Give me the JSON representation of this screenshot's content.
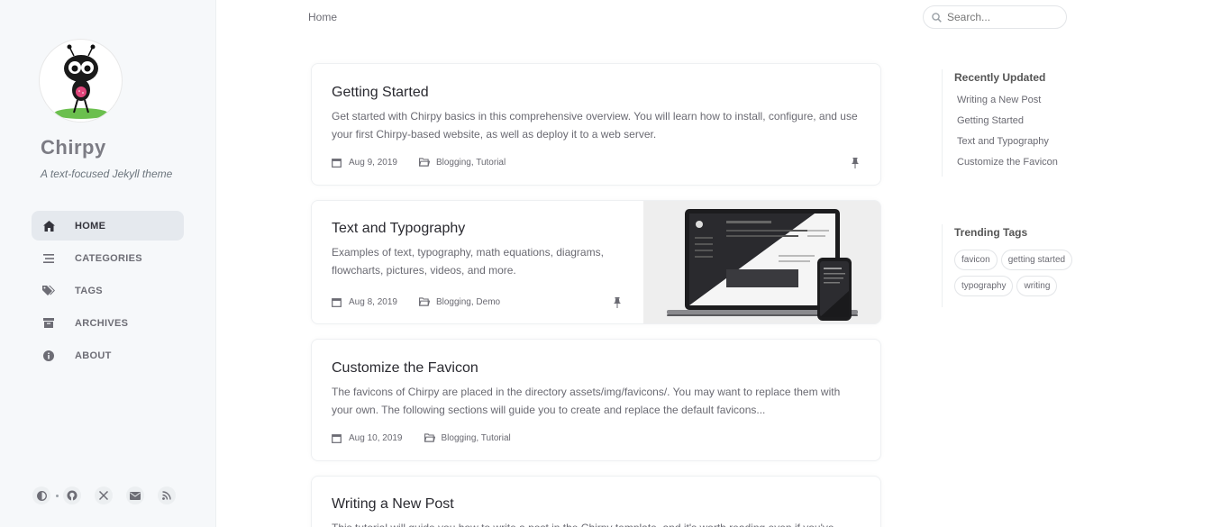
{
  "site": {
    "title": "Chirpy",
    "subtitle": "A text-focused Jekyll theme",
    "avatar_icon": "ant-mascot-avatar"
  },
  "nav": {
    "items": [
      {
        "label": "HOME",
        "icon": "home-icon",
        "active": true
      },
      {
        "label": "CATEGORIES",
        "icon": "stream-icon",
        "active": false
      },
      {
        "label": "TAGS",
        "icon": "tags-icon",
        "active": false
      },
      {
        "label": "ARCHIVES",
        "icon": "archive-icon",
        "active": false
      },
      {
        "label": "ABOUT",
        "icon": "info-circle-icon",
        "active": false
      }
    ]
  },
  "sidebar_bottom": {
    "icons": [
      "theme-toggle-icon",
      "github-icon",
      "x-twitter-icon",
      "email-icon",
      "rss-icon"
    ]
  },
  "topbar": {
    "breadcrumb": "Home",
    "search_placeholder": "Search..."
  },
  "posts": [
    {
      "title": "Getting Started",
      "excerpt": "Get started with Chirpy basics in this comprehensive overview. You will learn how to install, configure, and use your first Chirpy-based website, as well as deploy it to a web server.",
      "date": "Aug 9, 2019",
      "categories": "Blogging, Tutorial",
      "pinned": true
    },
    {
      "title": "Text and Typography",
      "excerpt": "Examples of text, typography, math equations, diagrams, flowcharts, pictures, videos, and more.",
      "date": "Aug 8, 2019",
      "categories": "Blogging, Demo",
      "pinned": true,
      "has_preview_image": true
    },
    {
      "title": "Customize the Favicon",
      "excerpt": "The favicons of Chirpy are placed in the directory assets/img/favicons/. You may want to replace them with your own. The following sections will guide you to create and replace the default favicons...",
      "date": "Aug 10, 2019",
      "categories": "Blogging, Tutorial",
      "pinned": false
    },
    {
      "title": "Writing a New Post",
      "excerpt": "This tutorial will guide you how to write a post in the Chirpy template, and it's worth reading even if you've"
    }
  ],
  "recently_updated": {
    "heading": "Recently Updated",
    "items": [
      "Writing a New Post",
      "Getting Started",
      "Text and Typography",
      "Customize the Favicon"
    ]
  },
  "trending_tags": {
    "heading": "Trending Tags",
    "items": [
      "favicon",
      "getting started",
      "typography",
      "writing"
    ]
  },
  "colors": {
    "sidebar_bg": "#f6f8fa",
    "active_nav_bg": "#e5e9ee",
    "text": "#34343c",
    "muted": "#6a6a72"
  }
}
